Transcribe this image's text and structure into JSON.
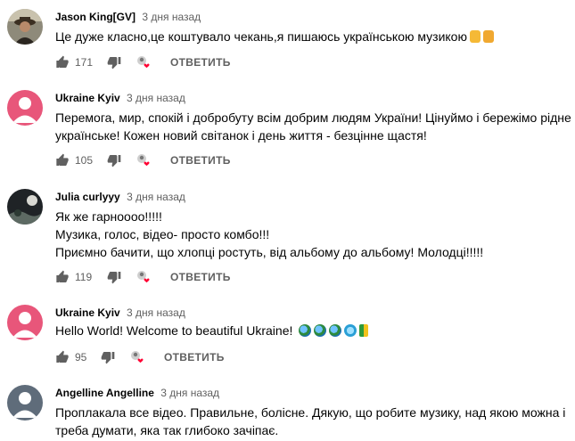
{
  "comments": [
    {
      "author": "Jason King[GV]",
      "time": "3 дня назад",
      "lines": [
        "Це дуже класно,це коштувало чекань,я пишаюсь українською музикою"
      ],
      "emojis": [
        "thumbs-up",
        "flexed-biceps"
      ],
      "likes": "171",
      "reply_label": "ОТВЕТИТЬ",
      "avatar": "photo"
    },
    {
      "author": "Ukraine Kyiv",
      "time": "3 дня назад",
      "lines": [
        "Перемога, мир, спокій і добробуту всім добрим людям України! Цінуймо і бережімо рідне -",
        "українське! Кожен новий світанок і день життя - безцінне щастя!"
      ],
      "likes": "105",
      "reply_label": "ОТВЕТИТЬ",
      "avatar": "default-pink"
    },
    {
      "author": "Julia curlyyy",
      "time": "3 дня назад",
      "lines": [
        "Як же гарноооо!!!!!",
        "Музика, голос, відео- просто комбо!!!",
        "Приємно бачити, що хлопці ростуть, від альбому до альбому! Молодці!!!!!"
      ],
      "likes": "119",
      "reply_label": "ОТВЕТИТЬ",
      "avatar": "photo-dark"
    },
    {
      "author": "Ukraine Kyiv",
      "time": "3 дня назад",
      "lines": [
        "Hello World! Welcome to beautiful Ukraine!"
      ],
      "emojis": [
        "globe",
        "globe",
        "globe",
        "globe-meridians",
        "japanese-beginner-badge"
      ],
      "likes": "95",
      "reply_label": "ОТВЕТИТЬ",
      "avatar": "default-pink"
    },
    {
      "author": "Angelline Angelline",
      "time": "3 дня назад",
      "lines": [
        "Проплакала все відео. Правильне, болісне. Дякую, що робите музику, над якою можна і",
        "треба думати, яка так глибоко зачіпає."
      ],
      "avatar": "default-gray"
    }
  ],
  "colors": {
    "pink_avatar": "#e8567a",
    "gray_avatar": "#5f6c7a",
    "meta": "#606060",
    "heart": "#ff0033"
  }
}
